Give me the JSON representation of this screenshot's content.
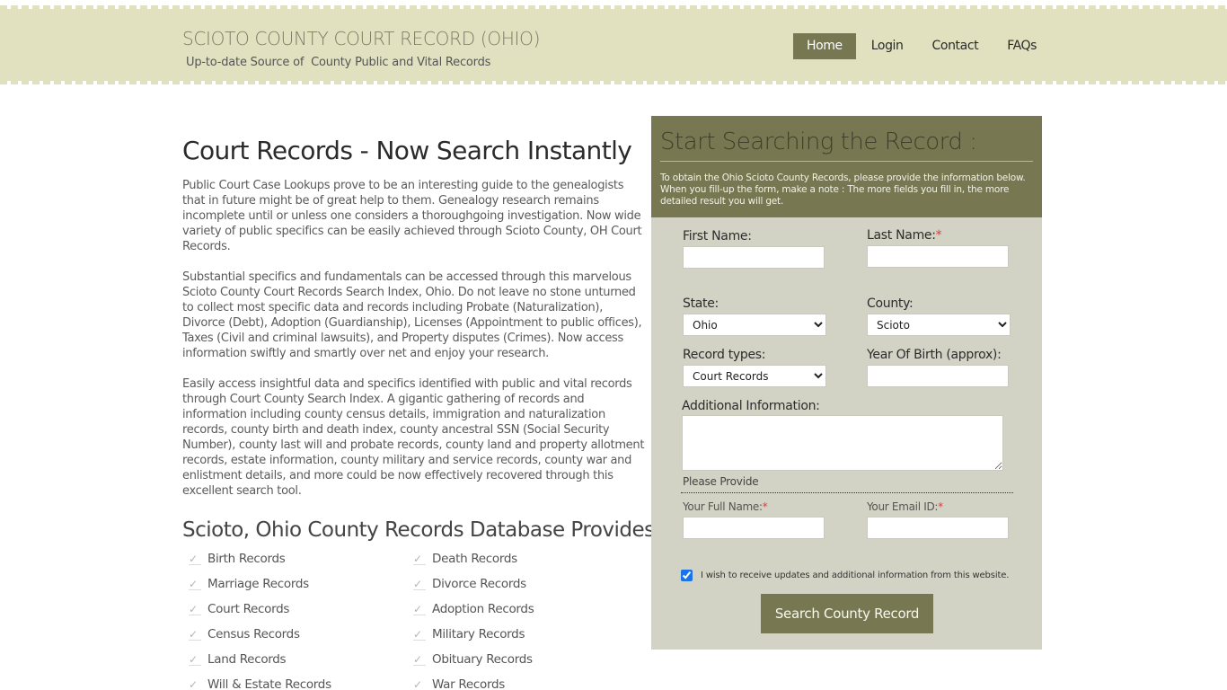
{
  "header": {
    "site_title": "SCIOTO COUNTY COURT RECORD (OHIO)",
    "tagline": "Up-to-date Source of  County Public and Vital Records",
    "nav": [
      {
        "label": "Home",
        "active": true
      },
      {
        "label": "Login",
        "active": false
      },
      {
        "label": "Contact",
        "active": false
      },
      {
        "label": "FAQs",
        "active": false
      }
    ]
  },
  "main": {
    "title": "Court Records - Now Search Instantly",
    "paragraphs": [
      "Public Court Case Lookups prove to be an interesting guide to the genealogists that in future might be of great help to them. Genealogy research remains incomplete until or unless one considers a thoroughgoing investigation. Now wide variety of public specifics can be easily achieved through Scioto County, OH Court Records.",
      "Substantial specifics and fundamentals can be accessed through this marvelous Scioto County Court Records Search Index, Ohio. Do not leave no stone unturned to collect most specific data and records including Probate (Naturalization), Divorce (Debt), Adoption (Guardianship), Licenses (Appointment to public offices), Taxes (Civil and criminal lawsuits), and Property disputes (Crimes). Now access information swiftly and smartly over net and enjoy your research.",
      "Easily access insightful data and specifics identified with public and vital records through Court County Search Index. A gigantic gathering of records and information including county census details, immigration and naturalization records, county birth and death index, county ancestral SSN (Social Security Number), county last will and probate records, county land and property allotment records, estate information, county military and service records, county war and enlistment details, and more could be now effectively recovered through this excellent search tool."
    ],
    "subtitle": "Scioto, Ohio County Records Database Provides",
    "records": [
      "Birth Records",
      "Death Records",
      "Marriage Records",
      "Divorce Records",
      "Court Records",
      "Adoption Records",
      "Census Records",
      "Military Records",
      "Land Records",
      "Obituary Records",
      "Will & Estate Records",
      "War Records"
    ]
  },
  "form": {
    "heading": "Start Searching the Record :",
    "intro": "To obtain the Ohio Scioto County Records, please provide the information below. When you fill-up the form, make a note : The more fields you fill in, the more detailed result you will get.",
    "first_name_label": "First Name:",
    "first_name_value": "",
    "last_name_label": "Last Name:",
    "last_name_value": "",
    "required_mark": "*",
    "state_label": "State:",
    "state_value": "Ohio",
    "county_label": "County:",
    "county_value": "Scioto",
    "record_types_label": "Record types:",
    "record_types_value": "Court Records",
    "year_of_birth_label": "Year Of Birth (approx):",
    "year_of_birth_value": "",
    "additional_info_label": "Additional Information:",
    "additional_info_value": "",
    "please_provide": "Please Provide",
    "full_name_label": "Your Full Name:",
    "full_name_value": "",
    "email_label": "Your Email ID:",
    "email_value": "",
    "consent_label": "I wish to receive updates and additional information from this website.",
    "consent_checked": true,
    "submit_label": "Search County Record"
  },
  "colors": {
    "header_bg": "#e1e1bf",
    "accent": "#777752",
    "panel_bg": "#d3d3c5",
    "required": "#ee3333"
  }
}
